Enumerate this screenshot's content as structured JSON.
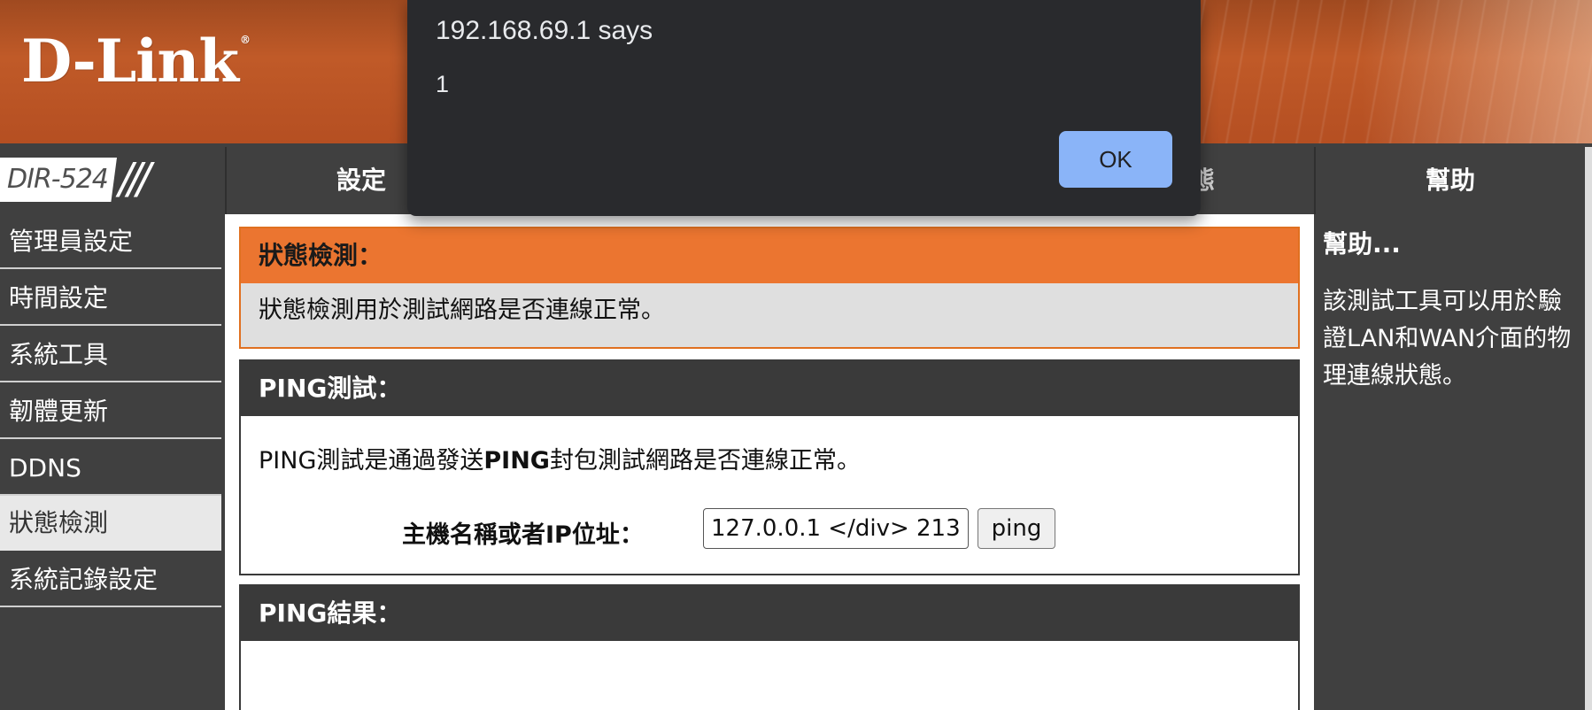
{
  "banner": {
    "logo_text": "D-Link",
    "logo_mark": "®"
  },
  "topnav": {
    "model": "DIR-524",
    "model_slashes": "///",
    "tabs": [
      {
        "label": "設定"
      },
      {
        "label": "態"
      },
      {
        "label": "幫助"
      }
    ]
  },
  "sidebar": {
    "items": [
      {
        "label": "管理員設定"
      },
      {
        "label": "時間設定"
      },
      {
        "label": "系統工具"
      },
      {
        "label": "韌體更新"
      },
      {
        "label": "DDNS"
      },
      {
        "label": "狀態檢測"
      },
      {
        "label": "系統記錄設定"
      }
    ],
    "active_index": 5
  },
  "main": {
    "status_section": {
      "title": "狀態檢測：",
      "description": "狀態檢測用於測試網路是否連線正常。"
    },
    "ping_section": {
      "title": "PING測試：",
      "desc_prefix": "PING測試是通過發送",
      "desc_bold": "PING",
      "desc_suffix": "封包測試網路是否連線正常。",
      "host_label": "主機名稱或者IP位址：",
      "host_value": "127.0.0.1 </div> 213",
      "ping_button": "ping"
    },
    "result_section": {
      "title": "PING結果："
    }
  },
  "help": {
    "title": "幫助...",
    "text": "該測試工具可以用於驗證LAN和WAN介面的物理連線狀態。"
  },
  "dialog": {
    "title": "192.168.69.1 says",
    "message": "1",
    "ok_label": "OK"
  },
  "colors": {
    "banner_orange": "#c05a28",
    "section_orange": "#eb7530",
    "dark_gray": "#404040",
    "dialog_bg": "#292a2d",
    "dialog_button": "#8ab4f8"
  }
}
